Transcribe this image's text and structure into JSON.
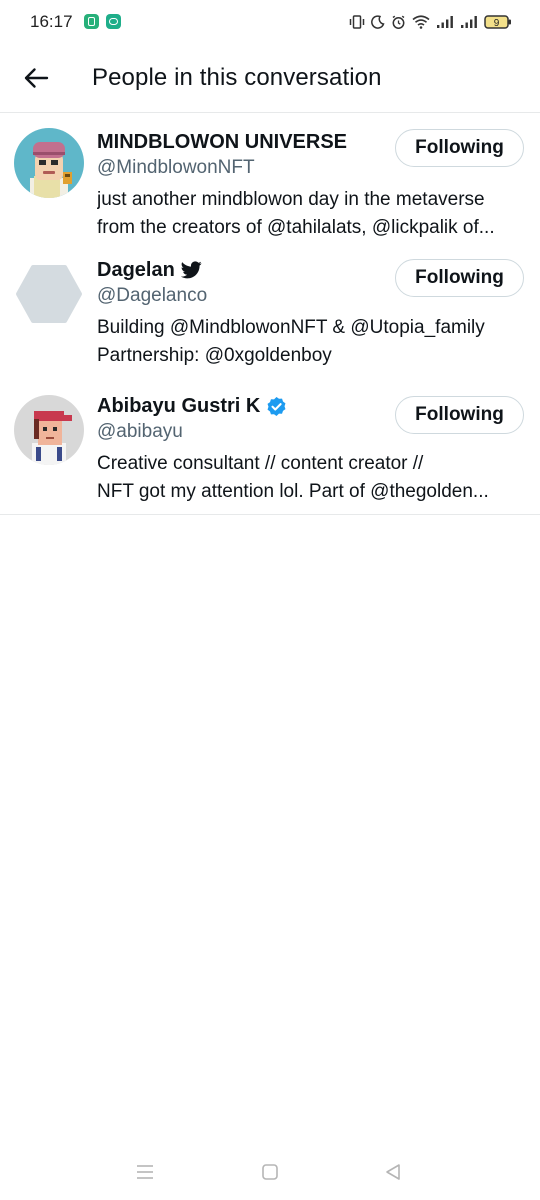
{
  "status_bar": {
    "time": "16:17",
    "battery_level": "9",
    "icons": [
      "vibrate-icon",
      "moon-icon",
      "alarm-icon",
      "wifi-icon",
      "signal-icon",
      "signal-icon",
      "battery-icon"
    ]
  },
  "header": {
    "title": "People in this conversation",
    "back_icon": "arrow-left-icon"
  },
  "people": [
    {
      "name": "MINDBLOWON UNIVERSE",
      "handle": "@MindblowonNFT",
      "bio_lines": [
        "just another mindblowon day in the metaverse",
        "from the creators of @tahilalats, @lickpalik of..."
      ],
      "follow_label": "Following",
      "badge": ""
    },
    {
      "name": "Dagelan",
      "handle": "@Dagelanco",
      "bio_lines": [
        "Building @MindblowonNFT & @Utopia_family",
        "Partnership: @0xgoldenboy"
      ],
      "follow_label": "Following",
      "badge": "twitter-bird-icon"
    },
    {
      "name": "Abibayu Gustri K",
      "handle": "@abibayu",
      "bio_lines": [
        "Creative consultant // content creator //",
        "NFT got my attention lol. Part of @thegolden..."
      ],
      "follow_label": "Following",
      "badge": "verified-badge-icon"
    }
  ],
  "colors": {
    "text_primary": "#0f1419",
    "text_secondary": "#536471",
    "divider": "#e7e9ea",
    "button_border": "#cfd9de",
    "verified_blue": "#1d9bf0"
  }
}
